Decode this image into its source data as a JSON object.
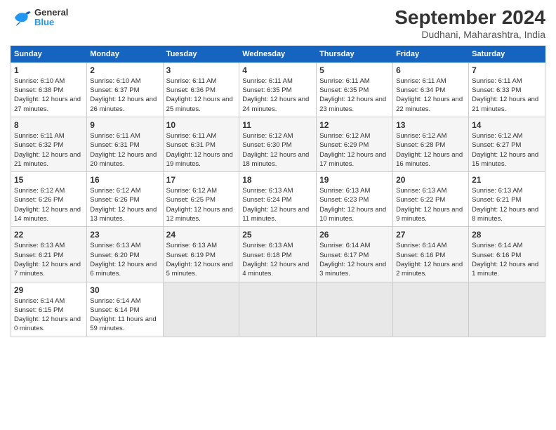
{
  "header": {
    "title": "September 2024",
    "subtitle": "Dudhani, Maharashtra, India",
    "logo_general": "General",
    "logo_blue": "Blue"
  },
  "columns": [
    "Sunday",
    "Monday",
    "Tuesday",
    "Wednesday",
    "Thursday",
    "Friday",
    "Saturday"
  ],
  "weeks": [
    [
      {
        "day": "1",
        "sunrise": "6:10 AM",
        "sunset": "6:38 PM",
        "daylight": "12 hours and 27 minutes."
      },
      {
        "day": "2",
        "sunrise": "6:10 AM",
        "sunset": "6:37 PM",
        "daylight": "12 hours and 26 minutes."
      },
      {
        "day": "3",
        "sunrise": "6:11 AM",
        "sunset": "6:36 PM",
        "daylight": "12 hours and 25 minutes."
      },
      {
        "day": "4",
        "sunrise": "6:11 AM",
        "sunset": "6:35 PM",
        "daylight": "12 hours and 24 minutes."
      },
      {
        "day": "5",
        "sunrise": "6:11 AM",
        "sunset": "6:35 PM",
        "daylight": "12 hours and 23 minutes."
      },
      {
        "day": "6",
        "sunrise": "6:11 AM",
        "sunset": "6:34 PM",
        "daylight": "12 hours and 22 minutes."
      },
      {
        "day": "7",
        "sunrise": "6:11 AM",
        "sunset": "6:33 PM",
        "daylight": "12 hours and 21 minutes."
      }
    ],
    [
      {
        "day": "8",
        "sunrise": "6:11 AM",
        "sunset": "6:32 PM",
        "daylight": "12 hours and 21 minutes."
      },
      {
        "day": "9",
        "sunrise": "6:11 AM",
        "sunset": "6:31 PM",
        "daylight": "12 hours and 20 minutes."
      },
      {
        "day": "10",
        "sunrise": "6:11 AM",
        "sunset": "6:31 PM",
        "daylight": "12 hours and 19 minutes."
      },
      {
        "day": "11",
        "sunrise": "6:12 AM",
        "sunset": "6:30 PM",
        "daylight": "12 hours and 18 minutes."
      },
      {
        "day": "12",
        "sunrise": "6:12 AM",
        "sunset": "6:29 PM",
        "daylight": "12 hours and 17 minutes."
      },
      {
        "day": "13",
        "sunrise": "6:12 AM",
        "sunset": "6:28 PM",
        "daylight": "12 hours and 16 minutes."
      },
      {
        "day": "14",
        "sunrise": "6:12 AM",
        "sunset": "6:27 PM",
        "daylight": "12 hours and 15 minutes."
      }
    ],
    [
      {
        "day": "15",
        "sunrise": "6:12 AM",
        "sunset": "6:26 PM",
        "daylight": "12 hours and 14 minutes."
      },
      {
        "day": "16",
        "sunrise": "6:12 AM",
        "sunset": "6:26 PM",
        "daylight": "12 hours and 13 minutes."
      },
      {
        "day": "17",
        "sunrise": "6:12 AM",
        "sunset": "6:25 PM",
        "daylight": "12 hours and 12 minutes."
      },
      {
        "day": "18",
        "sunrise": "6:13 AM",
        "sunset": "6:24 PM",
        "daylight": "12 hours and 11 minutes."
      },
      {
        "day": "19",
        "sunrise": "6:13 AM",
        "sunset": "6:23 PM",
        "daylight": "12 hours and 10 minutes."
      },
      {
        "day": "20",
        "sunrise": "6:13 AM",
        "sunset": "6:22 PM",
        "daylight": "12 hours and 9 minutes."
      },
      {
        "day": "21",
        "sunrise": "6:13 AM",
        "sunset": "6:21 PM",
        "daylight": "12 hours and 8 minutes."
      }
    ],
    [
      {
        "day": "22",
        "sunrise": "6:13 AM",
        "sunset": "6:21 PM",
        "daylight": "12 hours and 7 minutes."
      },
      {
        "day": "23",
        "sunrise": "6:13 AM",
        "sunset": "6:20 PM",
        "daylight": "12 hours and 6 minutes."
      },
      {
        "day": "24",
        "sunrise": "6:13 AM",
        "sunset": "6:19 PM",
        "daylight": "12 hours and 5 minutes."
      },
      {
        "day": "25",
        "sunrise": "6:13 AM",
        "sunset": "6:18 PM",
        "daylight": "12 hours and 4 minutes."
      },
      {
        "day": "26",
        "sunrise": "6:14 AM",
        "sunset": "6:17 PM",
        "daylight": "12 hours and 3 minutes."
      },
      {
        "day": "27",
        "sunrise": "6:14 AM",
        "sunset": "6:16 PM",
        "daylight": "12 hours and 2 minutes."
      },
      {
        "day": "28",
        "sunrise": "6:14 AM",
        "sunset": "6:16 PM",
        "daylight": "12 hours and 1 minute."
      }
    ],
    [
      {
        "day": "29",
        "sunrise": "6:14 AM",
        "sunset": "6:15 PM",
        "daylight": "12 hours and 0 minutes."
      },
      {
        "day": "30",
        "sunrise": "6:14 AM",
        "sunset": "6:14 PM",
        "daylight": "11 hours and 59 minutes."
      },
      null,
      null,
      null,
      null,
      null
    ]
  ]
}
